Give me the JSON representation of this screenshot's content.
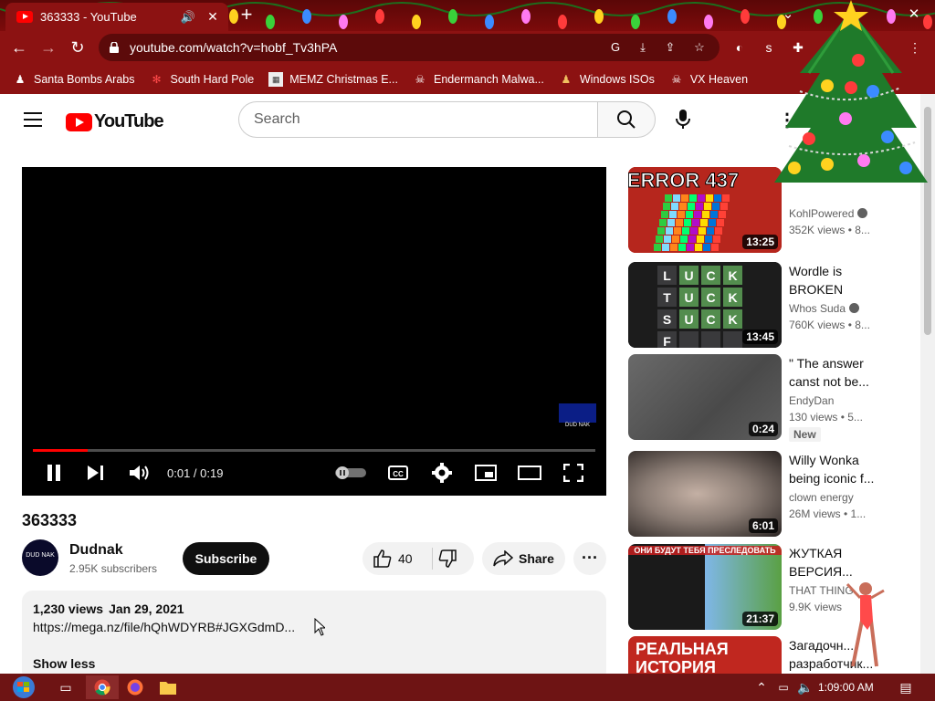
{
  "browser": {
    "tab_title": "363333 - YouTube",
    "url": "youtube.com/watch?v=hobf_Tv3hPA",
    "bookmarks": [
      {
        "label": "Santa Bombs Arabs",
        "icon": "figure-icon"
      },
      {
        "label": "South Hard Pole",
        "icon": "snowflake-icon"
      },
      {
        "label": "MEMZ Christmas E...",
        "icon": "window-icon"
      },
      {
        "label": "Endermanch Malwa...",
        "icon": "skull-icon"
      },
      {
        "label": "Windows ISOs",
        "icon": "figure-icon"
      },
      {
        "label": "VX Heaven",
        "icon": "skull-icon"
      }
    ]
  },
  "masthead": {
    "logo_text": "YouTube",
    "search_placeholder": "Search"
  },
  "player": {
    "time_current": "0:01",
    "time_total": "0:19",
    "time_display": "0:01 / 0:19",
    "progress_fraction": 0.097,
    "watermark_text": "DUD NAK"
  },
  "video": {
    "title": "363333",
    "channel_name": "Dudnak",
    "channel_avatar_text": "DUD NAK",
    "subscribers": "2.95K subscribers",
    "subscribe_label": "Subscribe",
    "like_count": "40",
    "share_label": "Share",
    "views": "1,230 views",
    "date": "Jan 29, 2021",
    "description_link": "https://mega.nz/file/hQhWDYRB#JGXGdmD...",
    "show_less_label": "Show less"
  },
  "sidebar": [
    {
      "title": "...",
      "channel": "KohlPowered",
      "views": "352K views • 8...",
      "duration": "13:25",
      "verified": true,
      "badge": "",
      "thumb_color": "#c0271f",
      "thumb_text": "ERROR 437"
    },
    {
      "title": "Wordle is BROKEN",
      "channel": "Whos Suda",
      "views": "760K views • 8...",
      "duration": "13:45",
      "verified": true,
      "badge": "",
      "thumb_color": "#2a2a2a",
      "thumb_text": ""
    },
    {
      "title": "\" The answer canst not be...",
      "channel": "EndyDan",
      "views": "130 views • 5...",
      "duration": "0:24",
      "verified": false,
      "badge": "New",
      "thumb_color": "#5a5a5a",
      "thumb_text": ""
    },
    {
      "title": "Willy Wonka being iconic f...",
      "channel": "clown energy",
      "views": "26M views • 1...",
      "duration": "6:01",
      "verified": false,
      "badge": "",
      "thumb_color": "#8a7c74",
      "thumb_text": ""
    },
    {
      "title": "ЖУТКАЯ ВЕРСИЯ...",
      "channel": "THAT THING",
      "views": "9.9K views",
      "duration": "21:37",
      "verified": false,
      "badge": "",
      "thumb_color": "#2f6fb0",
      "thumb_text": "ОНИ БУДУТ ТЕБЯ ПРЕСЛЕДОВАТЬ"
    },
    {
      "title": "Загадочн... разработчик...",
      "channel": "",
      "views": "",
      "duration": "",
      "verified": false,
      "badge": "",
      "thumb_color": "#c0271f",
      "thumb_text": "РЕАЛЬНАЯ ИСТОРИЯ"
    }
  ],
  "taskbar": {
    "clock": "1:09:00 AM"
  },
  "colors": {
    "chrome_frame": "#8c1212",
    "youtube_red": "#ff0000",
    "subscribe_bg": "#0f0f0f"
  }
}
